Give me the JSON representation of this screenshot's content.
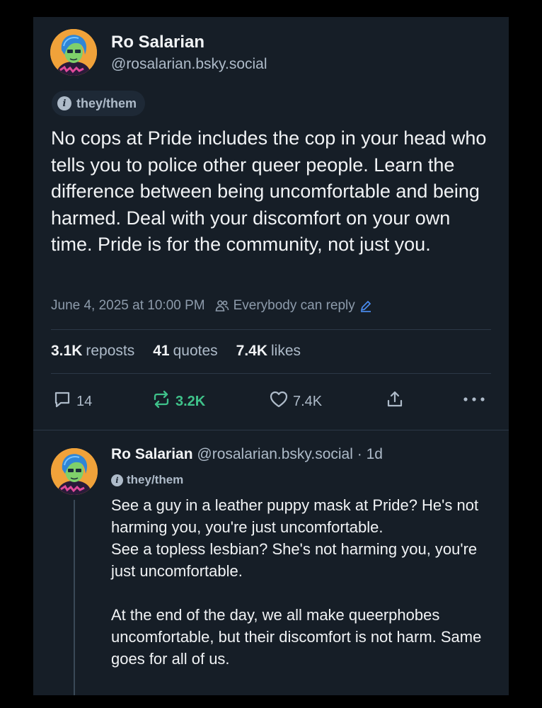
{
  "post": {
    "display_name": "Ro Salarian",
    "handle": "@rosalarian.bsky.social",
    "pronouns": "they/them",
    "text": "No cops at Pride includes the cop in your head who tells you to police other queer people. Learn the difference between being uncomfortable and being harmed. Deal with your discomfort on your own time. Pride is for the community, not just you.",
    "timestamp": "June 4, 2025 at 10:00 PM",
    "reply_setting": "Everybody can reply",
    "stats": {
      "reposts_count": "3.1K",
      "reposts_label": "reposts",
      "quotes_count": "41",
      "quotes_label": "quotes",
      "likes_count": "7.4K",
      "likes_label": "likes"
    },
    "actions": {
      "reply_count": "14",
      "repost_count": "3.2K",
      "like_count": "7.4K"
    }
  },
  "reply": {
    "display_name": "Ro Salarian",
    "handle_time": "@rosalarian.bsky.social · 1d",
    "pronouns": "they/them",
    "text": "See a guy in a leather puppy mask at Pride? He's not harming you, you're just uncomfortable.\nSee a topless lesbian? She's not harming you, you're just uncomfortable.\n\nAt the end of the day, we all make queerphobes uncomfortable, but their discomfort is not harm. Same goes for all of us."
  },
  "colors": {
    "background": "#161e27",
    "text": "#f1f3f5",
    "muted": "#aebbc9",
    "repost_active": "#3fc28a",
    "link": "#4a8cf0"
  },
  "icons": [
    "info-icon",
    "people-icon",
    "pencil-icon",
    "reply-icon",
    "repost-icon",
    "heart-icon",
    "share-icon",
    "more-icon"
  ]
}
